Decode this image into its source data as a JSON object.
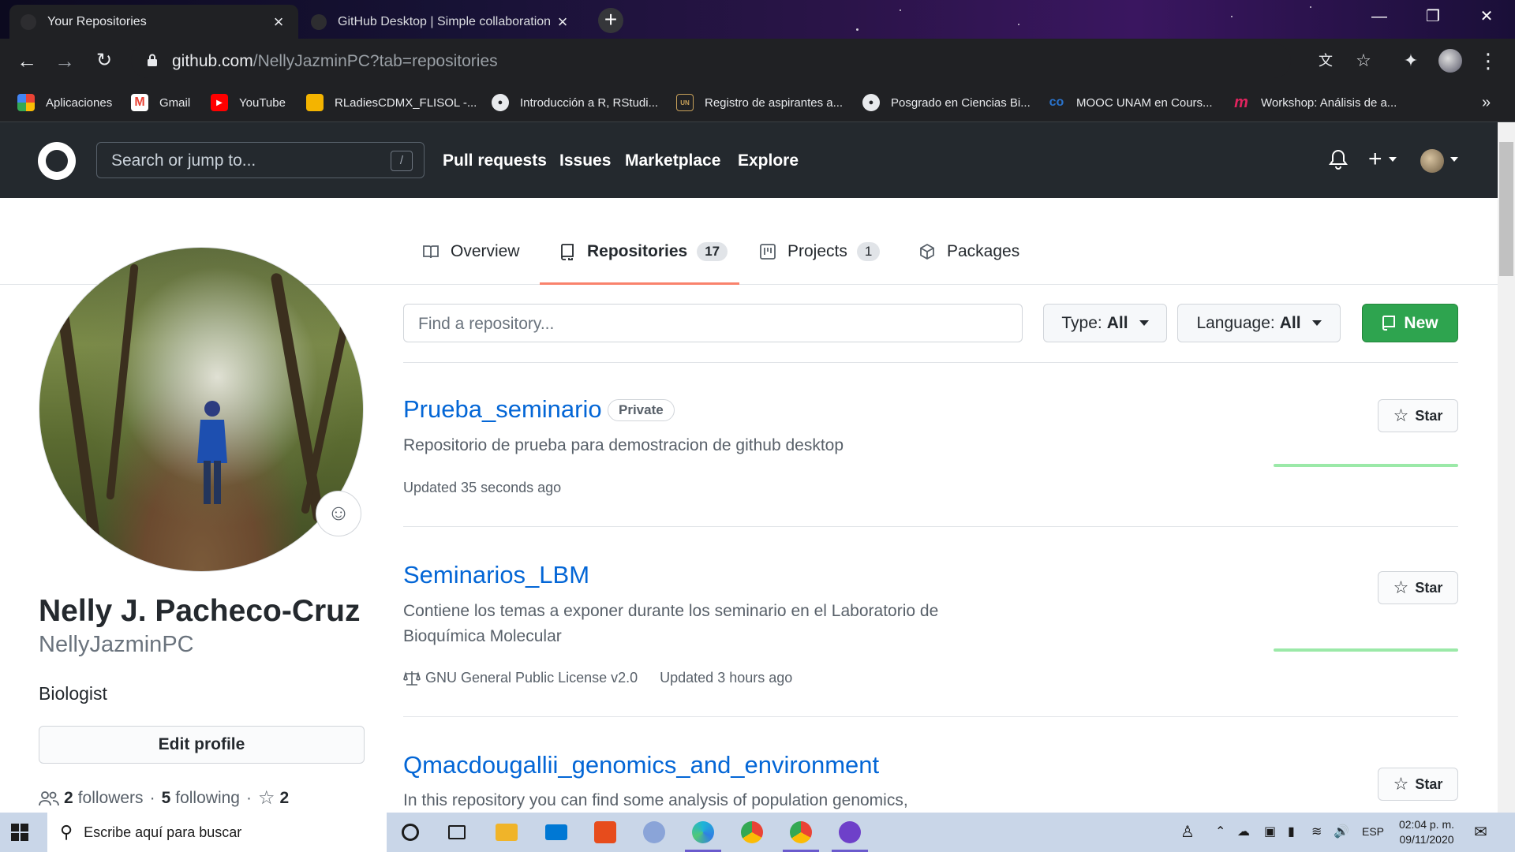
{
  "browser": {
    "tabs": [
      {
        "title": "Your Repositories",
        "active": true
      },
      {
        "title": "GitHub Desktop | Simple collaboration f",
        "active": false
      }
    ],
    "url_host": "github.com",
    "url_path": "/NellyJazminPC?tab=repositories",
    "bookmarks": [
      {
        "label": "Aplicaciones",
        "icon": "apps-grid-icon"
      },
      {
        "label": "Gmail",
        "icon": "gmail-icon"
      },
      {
        "label": "YouTube",
        "icon": "youtube-icon"
      },
      {
        "label": "RLadiesCDMX_FLISOL -...",
        "icon": "slides-icon"
      },
      {
        "label": "Introducción a R, RStudi...",
        "icon": "globe-icon"
      },
      {
        "label": "Registro de aspirantes a...",
        "icon": "unam-icon"
      },
      {
        "label": "Posgrado en Ciencias Bi...",
        "icon": "globe-icon"
      },
      {
        "label": "MOOC UNAM en Cours...",
        "icon": "coursera-icon"
      },
      {
        "label": "Workshop: Análisis de a...",
        "icon": "workshop-icon"
      }
    ],
    "more_bookmarks": "»"
  },
  "github": {
    "search_placeholder": "Search or jump to...",
    "search_key": "/",
    "nav": [
      "Pull requests",
      "Issues",
      "Marketplace",
      "Explore"
    ]
  },
  "profile_tabs": [
    {
      "label": "Overview",
      "count": ""
    },
    {
      "label": "Repositories",
      "count": "17"
    },
    {
      "label": "Projects",
      "count": "1"
    },
    {
      "label": "Packages",
      "count": ""
    }
  ],
  "profile": {
    "name": "Nelly J. Pacheco-Cruz",
    "username": "NellyJazminPC",
    "bio": "Biologist",
    "edit_label": "Edit profile",
    "followers_count": "2",
    "followers_label": "followers",
    "separator": "·",
    "following_count": "5",
    "following_label": "following",
    "stars_count": "2"
  },
  "repo_toolbar": {
    "find_placeholder": "Find a repository...",
    "type_label": "Type:",
    "type_value": "All",
    "language_label": "Language:",
    "language_value": "All",
    "new_label": "New"
  },
  "repos": [
    {
      "name": "Prueba_seminario",
      "badge": "Private",
      "description": "Repositorio de prueba para demostracion de github desktop",
      "license": "",
      "updated": "Updated 35 seconds ago",
      "star_label": "Star"
    },
    {
      "name": "Seminarios_LBM",
      "badge": "",
      "description": "Contiene los temas a exponer durante los seminario en el Laboratorio de Bioquímica Molecular",
      "license": "GNU General Public License v2.0",
      "updated": "Updated 3 hours ago",
      "star_label": "Star"
    },
    {
      "name": "Qmacdougallii_genomics_and_environment",
      "badge": "",
      "description": "In this repository you can find some analysis of population genomics,",
      "license": "",
      "updated": "",
      "star_label": "Star"
    }
  ],
  "taskbar": {
    "search_placeholder": "Escribe aquí para buscar",
    "language": "ESP",
    "time": "02:04 p. m.",
    "date": "09/11/2020"
  }
}
